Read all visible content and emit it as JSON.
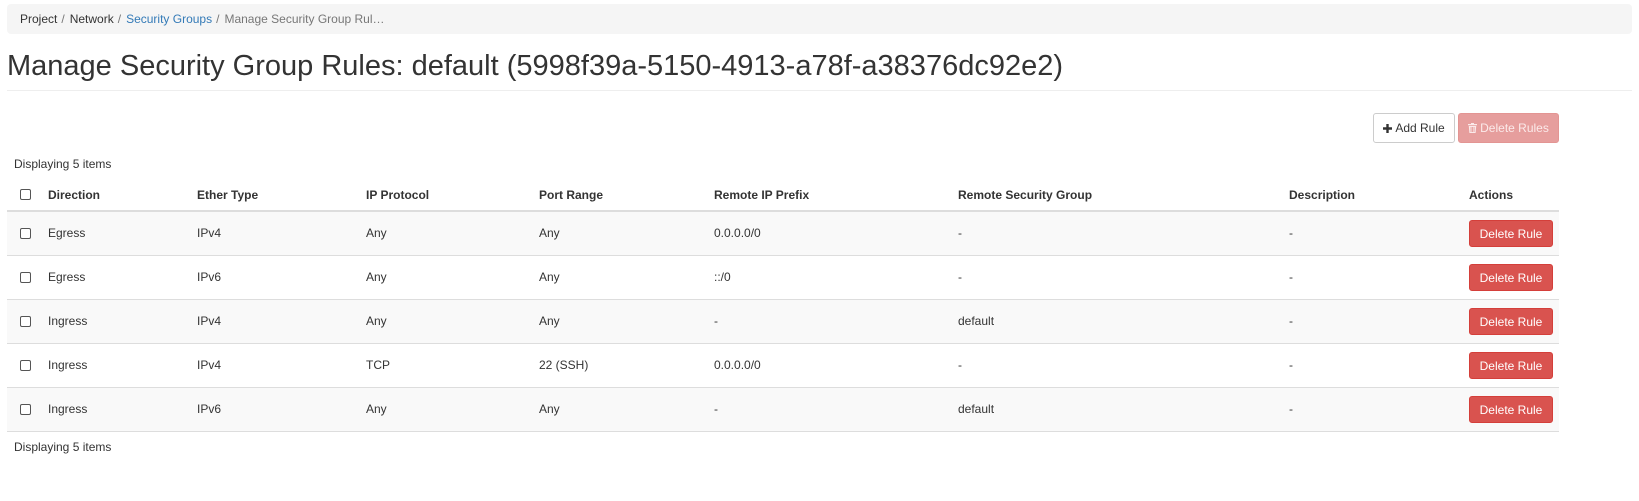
{
  "breadcrumb": {
    "items": [
      {
        "label": "Project"
      },
      {
        "label": "Network"
      },
      {
        "label": "Security Groups"
      },
      {
        "label": "Manage Security Group Rul…"
      }
    ],
    "separator": "/"
  },
  "page": {
    "title": "Manage Security Group Rules: default (5998f39a-5150-4913-a78f-a38376dc92e2)"
  },
  "table_actions": {
    "add_rule": {
      "label": "Add Rule",
      "icon": "plus-icon"
    },
    "delete_rules": {
      "label": "Delete Rules",
      "icon": "trash-icon",
      "disabled": true
    }
  },
  "table": {
    "count_text": "Displaying 5 items",
    "columns": [
      "Direction",
      "Ether Type",
      "IP Protocol",
      "Port Range",
      "Remote IP Prefix",
      "Remote Security Group",
      "Description",
      "Actions"
    ],
    "rows": [
      {
        "direction": "Egress",
        "ether_type": "IPv4",
        "ip_protocol": "Any",
        "port_range": "Any",
        "remote_ip_prefix": "0.0.0.0/0",
        "remote_security_group": "-",
        "description": "-",
        "action": "Delete Rule"
      },
      {
        "direction": "Egress",
        "ether_type": "IPv6",
        "ip_protocol": "Any",
        "port_range": "Any",
        "remote_ip_prefix": "::/0",
        "remote_security_group": "-",
        "description": "-",
        "action": "Delete Rule"
      },
      {
        "direction": "Ingress",
        "ether_type": "IPv4",
        "ip_protocol": "Any",
        "port_range": "Any",
        "remote_ip_prefix": "-",
        "remote_security_group": "default",
        "description": "-",
        "action": "Delete Rule"
      },
      {
        "direction": "Ingress",
        "ether_type": "IPv4",
        "ip_protocol": "TCP",
        "port_range": "22 (SSH)",
        "remote_ip_prefix": "0.0.0.0/0",
        "remote_security_group": "-",
        "description": "-",
        "action": "Delete Rule"
      },
      {
        "direction": "Ingress",
        "ether_type": "IPv6",
        "ip_protocol": "Any",
        "port_range": "Any",
        "remote_ip_prefix": "-",
        "remote_security_group": "default",
        "description": "-",
        "action": "Delete Rule"
      }
    ]
  },
  "colors": {
    "link": "#337ab7",
    "danger": "#d9534f",
    "danger_disabled": "#e69e9d",
    "breadcrumb_bg": "#f5f5f5",
    "row_stripe": "#f9f9f9",
    "border": "#dddddd"
  }
}
